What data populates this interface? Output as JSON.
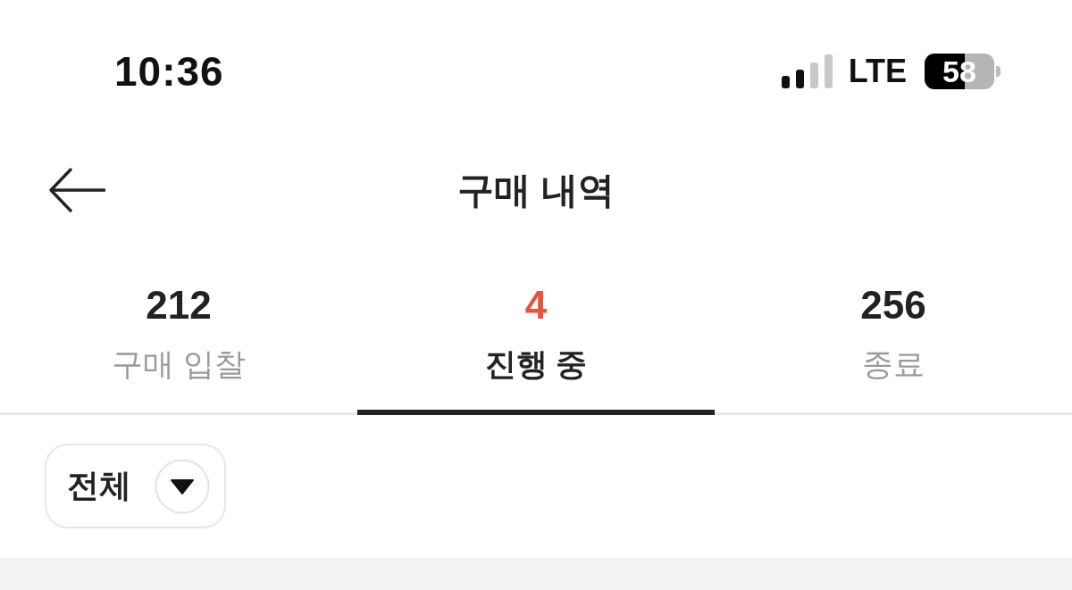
{
  "status_bar": {
    "time": "10:36",
    "network": "LTE",
    "battery": "58"
  },
  "header": {
    "title": "구매 내역"
  },
  "tabs": [
    {
      "count": "212",
      "label": "구매 입찰",
      "selected": false
    },
    {
      "count": "4",
      "label": "진행 중",
      "selected": true
    },
    {
      "count": "256",
      "label": "종료",
      "selected": false
    }
  ],
  "filter": {
    "label": "전체"
  }
}
